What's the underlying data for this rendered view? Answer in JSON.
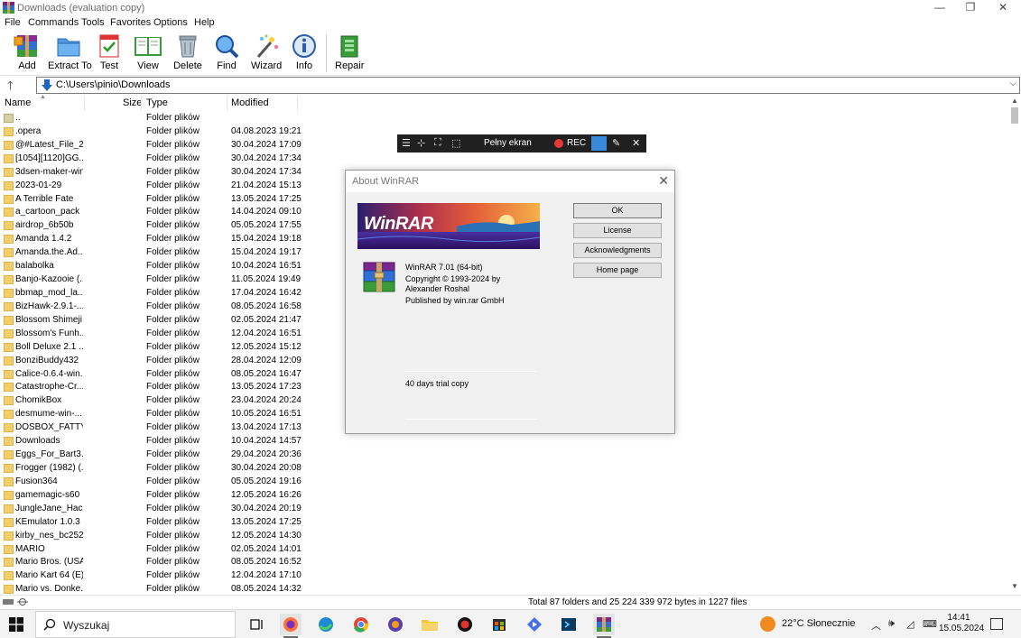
{
  "window": {
    "title": "Downloads (evaluation copy)",
    "controls": [
      "minimize",
      "restore",
      "close"
    ]
  },
  "menu": [
    "File",
    "Commands",
    "Tools",
    "Favorites",
    "Options",
    "Help"
  ],
  "toolbar": {
    "add": "Add",
    "extract": "Extract To",
    "test": "Test",
    "view": "View",
    "delete": "Delete",
    "find": "Find",
    "wizard": "Wizard",
    "info": "Info",
    "repair": "Repair"
  },
  "address": {
    "path": "C:\\Users\\pinio\\Downloads"
  },
  "columns": {
    "name": "Name",
    "size": "Size",
    "type": "Type",
    "modified": "Modified"
  },
  "files": [
    {
      "name": "..",
      "type": "Folder plików",
      "modified": ""
    },
    {
      "name": ".opera",
      "type": "Folder plików",
      "modified": "04.08.2023 19:21"
    },
    {
      "name": "@#Latest_File_2...",
      "type": "Folder plików",
      "modified": "30.04.2024 17:09"
    },
    {
      "name": "[1054][1120]GG...",
      "type": "Folder plików",
      "modified": "30.04.2024 17:34"
    },
    {
      "name": "3dsen-maker-win",
      "type": "Folder plików",
      "modified": "30.04.2024 17:34"
    },
    {
      "name": "2023-01-29",
      "type": "Folder plików",
      "modified": "21.04.2024 15:13"
    },
    {
      "name": "A Terrible Fate",
      "type": "Folder plików",
      "modified": "13.05.2024 17:25"
    },
    {
      "name": "a_cartoon_pack",
      "type": "Folder plików",
      "modified": "14.04.2024 09:10"
    },
    {
      "name": "airdrop_6b50b",
      "type": "Folder plików",
      "modified": "05.05.2024 17:55"
    },
    {
      "name": "Amanda 1.4.2",
      "type": "Folder plików",
      "modified": "15.04.2024 19:18"
    },
    {
      "name": "Amanda.the.Ad...",
      "type": "Folder plików",
      "modified": "15.04.2024 19:17"
    },
    {
      "name": "balabolka",
      "type": "Folder plików",
      "modified": "10.04.2024 16:51"
    },
    {
      "name": "Banjo-Kazooie (...",
      "type": "Folder plików",
      "modified": "11.05.2024 19:49"
    },
    {
      "name": "bbmap_mod_la...",
      "type": "Folder plików",
      "modified": "17.04.2024 16:42"
    },
    {
      "name": "BizHawk-2.9.1-...",
      "type": "Folder plików",
      "modified": "08.05.2024 16:58"
    },
    {
      "name": "Blossom Shimeji",
      "type": "Folder plików",
      "modified": "02.05.2024 21:47"
    },
    {
      "name": "Blossom's Funh...",
      "type": "Folder plików",
      "modified": "12.04.2024 16:51"
    },
    {
      "name": "Boll Deluxe 2.1 ...",
      "type": "Folder plików",
      "modified": "12.05.2024 15:12"
    },
    {
      "name": "BonziBuddy432",
      "type": "Folder plików",
      "modified": "28.04.2024 12:09"
    },
    {
      "name": "Calice-0.6.4-win...",
      "type": "Folder plików",
      "modified": "08.05.2024 16:47"
    },
    {
      "name": "Catastrophe-Cr...",
      "type": "Folder plików",
      "modified": "13.05.2024 17:23"
    },
    {
      "name": "ChomikBox",
      "type": "Folder plików",
      "modified": "23.04.2024 20:24"
    },
    {
      "name": "desmume-win-...",
      "type": "Folder plików",
      "modified": "10.05.2024 16:51"
    },
    {
      "name": "DOSBOX_FATTY...",
      "type": "Folder plików",
      "modified": "13.04.2024 17:13"
    },
    {
      "name": "Downloads",
      "type": "Folder plików",
      "modified": "10.04.2024 14:57"
    },
    {
      "name": "Eggs_For_Bart3...",
      "type": "Folder plików",
      "modified": "29.04.2024 20:36"
    },
    {
      "name": "Frogger (1982) (...",
      "type": "Folder plików",
      "modified": "30.04.2024 20:08"
    },
    {
      "name": "Fusion364",
      "type": "Folder plików",
      "modified": "05.05.2024 19:16"
    },
    {
      "name": "gamemagic-s60",
      "type": "Folder plików",
      "modified": "12.05.2024 16:26"
    },
    {
      "name": "JungleJane_Hack",
      "type": "Folder plików",
      "modified": "30.04.2024 20:19"
    },
    {
      "name": "KEmulator 1.0.3 ...",
      "type": "Folder plików",
      "modified": "13.05.2024 17:25"
    },
    {
      "name": "kirby_nes_bc252",
      "type": "Folder plików",
      "modified": "12.05.2024 14:30"
    },
    {
      "name": "MARIO",
      "type": "Folder plików",
      "modified": "02.05.2024 14:01"
    },
    {
      "name": "Mario Bros. (USA)",
      "type": "Folder plików",
      "modified": "08.05.2024 16:52"
    },
    {
      "name": "Mario Kart 64 (E)...",
      "type": "Folder plików",
      "modified": "12.04.2024 17:10"
    },
    {
      "name": "Mario vs. Donke...",
      "type": "Folder plików",
      "modified": "08.05.2024 14:32"
    }
  ],
  "status": {
    "text": "Total 87 folders and 25 224 339 972 bytes in 1227 files"
  },
  "recorder": {
    "fullscreen": "Pełny ekran",
    "rec": "REC"
  },
  "about": {
    "title": "About WinRAR",
    "banner": "WinRAR",
    "version": "WinRAR 7.01 (64-bit)",
    "copyright1": "Copyright © 1993-2024 by",
    "copyright2": "Alexander Roshal",
    "publisher": "Published by win.rar GmbH",
    "trial": "40 days trial copy",
    "buttons": {
      "ok": "OK",
      "license": "License",
      "acknowledgments": "Acknowledgments",
      "homepage": "Home page"
    }
  },
  "taskbar": {
    "search_placeholder": "Wyszukaj",
    "weather": "22°C  Słonecznie",
    "time": "14:41",
    "date": "15.05.2024"
  },
  "colors": {
    "folder": "#f2cf6a",
    "rec_red": "#e53935",
    "selection_blue": "#3a88d8"
  }
}
